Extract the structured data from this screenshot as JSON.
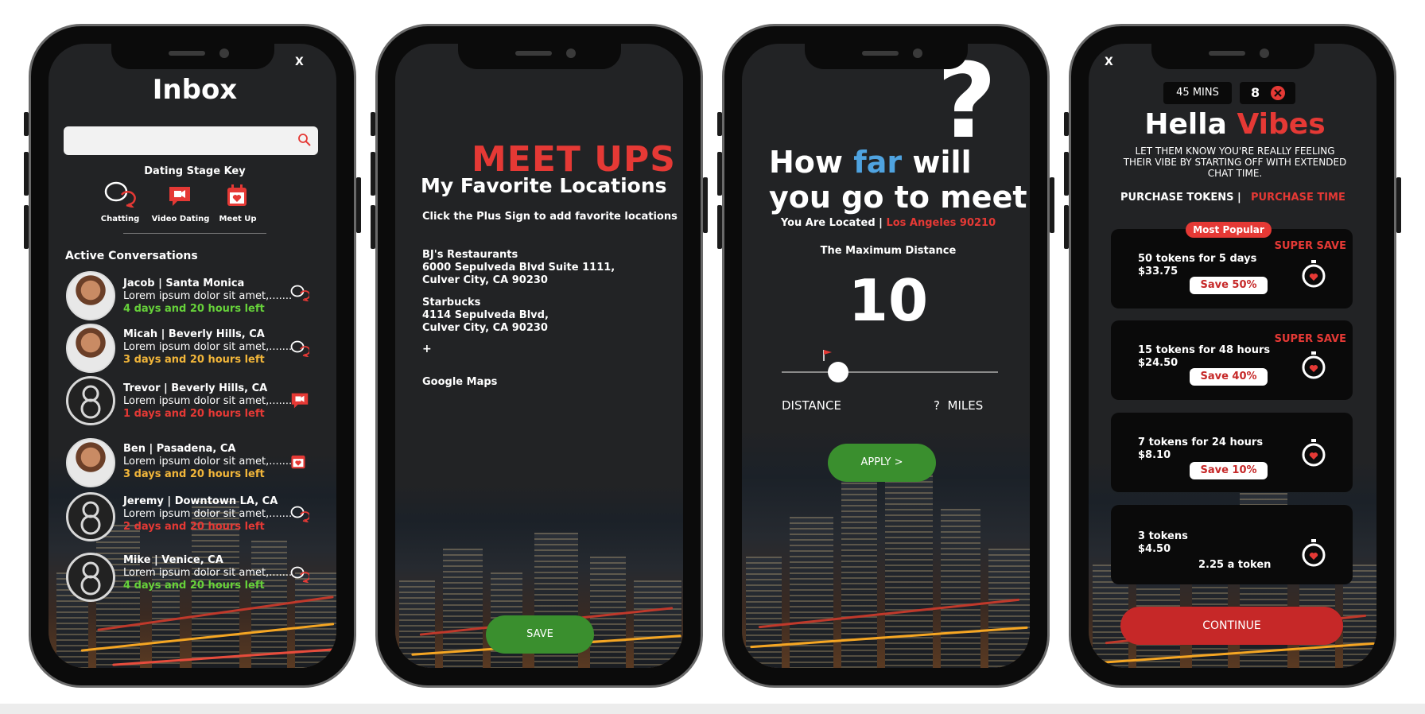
{
  "colors": {
    "red": "#e53935",
    "green": "#3a8f2e",
    "blue": "#4fa3e0",
    "yellow": "#f2b63a",
    "lime": "#66d13a",
    "card": "#0a0a0a"
  },
  "inbox": {
    "close": "X",
    "title": "Inbox",
    "search_placeholder": "",
    "key_title": "Dating Stage Key",
    "key_items": [
      {
        "label": "Chatting",
        "icon": "chat-bubbles-icon"
      },
      {
        "label": "Video Dating",
        "icon": "video-chat-icon"
      },
      {
        "label": "Meet Up",
        "icon": "calendar-heart-icon"
      }
    ],
    "active_title": "Active Conversations",
    "conversations": [
      {
        "name": "Jacob | Santa Monica",
        "msg": "Lorem ipsum dolor sit amet,.......",
        "time": "4 days and 20 hours left",
        "time_color": "#66d13a",
        "stage": "chatting"
      },
      {
        "name": "Micah | Beverly Hills, CA",
        "msg": "Lorem ipsum dolor sit amet,.......",
        "time": "3 days and 20 hours left",
        "time_color": "#f2b63a",
        "stage": "chatting"
      },
      {
        "name": "Trevor | Beverly Hills, CA",
        "msg": "Lorem ipsum dolor sit amet,.......",
        "time": "1 days and 20 hours left",
        "time_color": "#e53935",
        "stage": "video"
      },
      {
        "name": "Ben | Pasadena, CA",
        "msg": "Lorem ipsum dolor sit amet,.......",
        "time": "3 days and 20 hours left",
        "time_color": "#f2b63a",
        "stage": "meetup"
      },
      {
        "name": "Jeremy | Downtown LA, CA",
        "msg": "Lorem ipsum dolor sit amet,.......",
        "time": "2 days and 20 hours left",
        "time_color": "#e53935",
        "stage": "chatting"
      },
      {
        "name": "Mike | Venice, CA",
        "msg": "Lorem ipsum dolor sit amet,.......",
        "time": "4 days and 20 hours left",
        "time_color": "#66d13a",
        "stage": "chatting"
      }
    ]
  },
  "meetups": {
    "title": "MEET UPS",
    "subtitle": "My Favorite Locations",
    "instruction": "Click the Plus Sign to add favorite locations",
    "locations": [
      {
        "name": "BJ's Restaurants",
        "line1": "6000 Sepulveda Blvd Suite 1111,",
        "line2": "Culver City, CA 90230"
      },
      {
        "name": "Starbucks",
        "line1": "4114 Sepulveda Blvd,",
        "line2": "Culver City, CA 90230"
      }
    ],
    "plus": "+",
    "maps": "Google Maps",
    "save": "SAVE"
  },
  "distance": {
    "question_mark": "?",
    "heading_1": "How",
    "heading_far": "far",
    "heading_2": "will",
    "heading_3": "you go to meet",
    "located_label": "You Are Located |",
    "located_value": "Los Angeles 90210",
    "max_label": "The Maximum Distance",
    "value": "10",
    "slider_fraction": 0.26,
    "distance_label": "DISTANCE",
    "miles_q": "?",
    "miles_label": "MILES",
    "apply": "APPLY >"
  },
  "tokens": {
    "close": "X",
    "time_badge": "45 MINS",
    "count_badge": "8",
    "title_1": "Hella",
    "title_2": "Vibes",
    "desc_1": "LET THEM KNOW YOU'RE REALLY FEELING",
    "desc_2": "THEIR VIBE BY STARTING OFF WITH EXTENDED",
    "desc_3": "CHAT TIME.",
    "tab_1": "PURCHASE TOKENS",
    "tab_sep": "|",
    "tab_2": "PURCHASE TIME",
    "popular": "Most Popular",
    "plans": [
      {
        "line1": "50 tokens for 5 days",
        "line2": "$33.75",
        "tag": "SUPER SAVE",
        "pill": "Save 50%"
      },
      {
        "line1": "15 tokens for 48 hours",
        "line2": "$24.50",
        "tag": "SUPER SAVE",
        "pill": "Save 40%"
      },
      {
        "line1": "7 tokens for 24 hours",
        "line2": "$8.10",
        "tag": "",
        "pill": "Save 10%"
      },
      {
        "line1": "3 tokens",
        "line2": "$4.50",
        "tag": "",
        "pill": "",
        "note": "2.25 a token"
      }
    ],
    "continue": "CONTINUE"
  }
}
